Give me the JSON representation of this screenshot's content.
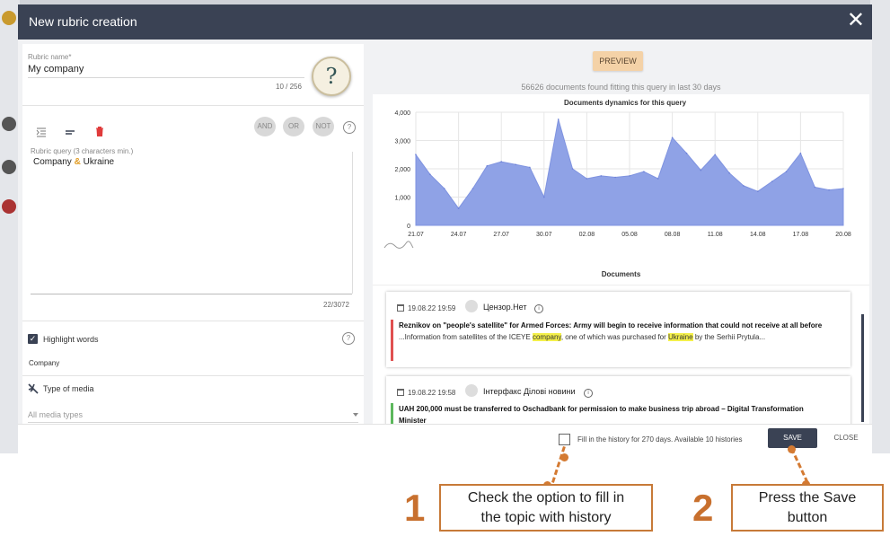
{
  "dialog": {
    "title": "New rubric creation"
  },
  "left_panel": {
    "rubric_name_label": "Rubric name",
    "rubric_name_required": "*",
    "rubric_name_value": "My company",
    "rubric_name_counter": "10 / 256",
    "operators": [
      "AND",
      "OR",
      "NOT"
    ],
    "query_label": "Rubric query (3 characters min.)",
    "query_term_1": "Company",
    "query_operator": "&",
    "query_term_2": "Ukraine",
    "query_counter": "22/3072",
    "highlight_label": "Highlight words",
    "highlight_words": "Company",
    "media_label": "Type of media",
    "media_placeholder": "All media types"
  },
  "preview": {
    "button_label": "PREVIEW",
    "found_text": "56626 documents found fitting this query in last 30 days"
  },
  "chart_data": {
    "type": "area",
    "title": "Documents dynamics for this query",
    "ylim": [
      0,
      4000
    ],
    "yticks": [
      "0",
      "1,000",
      "2,000",
      "3,000",
      "4,000"
    ],
    "xticks": [
      "21.07",
      "24.07",
      "27.07",
      "30.07",
      "02.08",
      "05.08",
      "08.08",
      "11.08",
      "14.08",
      "17.08",
      "20.08"
    ],
    "x": [
      0,
      1,
      2,
      3,
      4,
      5,
      6,
      7,
      8,
      9,
      10,
      11,
      12,
      13,
      14,
      15,
      16,
      17,
      18,
      19,
      20,
      21,
      22,
      23,
      24,
      25,
      26,
      27,
      28,
      29,
      30
    ],
    "values": [
      2500,
      1800,
      1300,
      600,
      1300,
      2100,
      2250,
      2150,
      2050,
      1000,
      3750,
      2000,
      1650,
      1750,
      1700,
      1750,
      1900,
      1650,
      3100,
      2550,
      1950,
      2500,
      1850,
      1400,
      1200,
      1550,
      1900,
      2550,
      1350,
      1250,
      1300
    ],
    "color": "#8fa2e6",
    "grid": true
  },
  "documents": {
    "title": "Documents",
    "items": [
      {
        "date": "19.08.22 19:59",
        "source": "Цензор.Нет",
        "accent": "#e05050",
        "headline": "Reznikov on \"people's satellite\" for Armed Forces: Army will begin to receive information that could not receive at all before",
        "snippet_1": "...Information from satellites of the ICEYE ",
        "highlight_1": "company",
        "snippet_2": ", one of which was purchased for ",
        "highlight_2": "Ukraine",
        "snippet_3": " by the Serhii Prytula..."
      },
      {
        "date": "19.08.22 19:58",
        "source": "Інтерфакс Ділові новини",
        "accent": "#5cb85c",
        "headline": "UAH 200,000 must be transferred to Oschadbank for permission to make business trip abroad – Digital Transformation",
        "headline_2": "Minister"
      }
    ]
  },
  "footer": {
    "history_text": "Fill in the history for 270 days. Available 10 histories",
    "save_label": "SAVE",
    "close_label": "CLOSE"
  },
  "annotations": [
    {
      "number": "1",
      "text_line_1": "Check the option to fill in",
      "text_line_2": "the topic with history"
    },
    {
      "number": "2",
      "text_line_1": "Press the Save",
      "text_line_2": "button"
    }
  ],
  "colors": {
    "header": "#3a4254",
    "accent_orange": "#d47a32",
    "highlight": "#f4f04a"
  }
}
